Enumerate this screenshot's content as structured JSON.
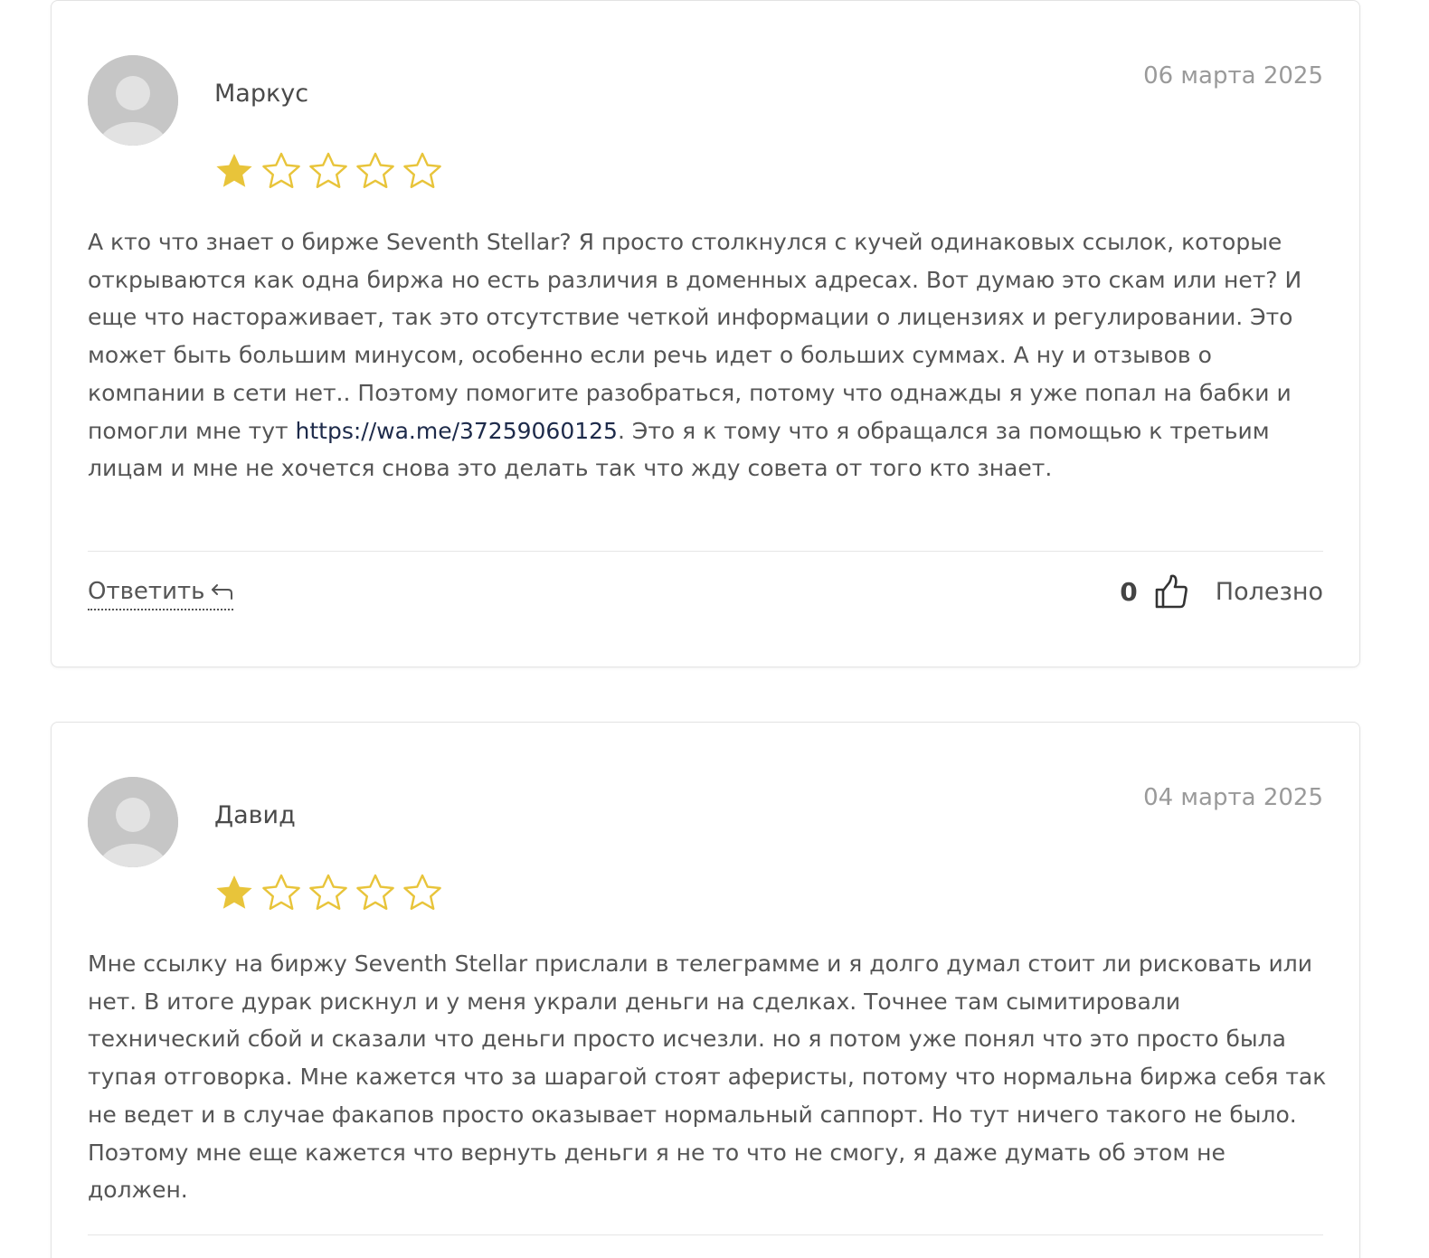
{
  "reviews": [
    {
      "author": "Маркус",
      "date": "06 марта 2025",
      "rating": 1,
      "max_rating": 5,
      "text_before_link": "А кто что знает о бирже Seventh Stellar? Я просто столкнулся с кучей одинаковых ссылок, которые открываются как одна биржа но есть различия в доменных адресах. Вот думаю это скам или нет? И еще что настораживает, так это отсутствие четкой информации о лицензиях и регулировании. Это может быть большим минусом, особенно если речь идет о больших суммах. А ну и отзывов о компании в сети нет.. Поэтому помогите разобраться, потому что однажды я уже попал на бабки и помогли мне тут ",
      "link": "https://wa.me/37259060125",
      "text_after_link": ". Это я к тому что я обращался за помощью к третьим лицам и мне не хочется снова это делать так что жду совета от того кто знает.",
      "reply_label": "Ответить",
      "helpful_count": "0",
      "helpful_label": "Полезно"
    },
    {
      "author": "Давид",
      "date": "04 марта 2025",
      "rating": 1,
      "max_rating": 5,
      "text": "Мне ссылку на биржу Seventh Stellar прислали в телеграмме и я долго думал стоит ли рисковать или нет. В итоге дурак рискнул и у меня украли деньги на сделках. Точнее там сымитировали технический сбой и сказали что деньги просто исчезли. но я потом уже понял что это просто была тупая отговорка. Мне кажется что за шарагой стоят аферисты, потому что нормальна биржа себя так не ведет и в случае факапов просто оказывает нормальный саппорт. Но тут ничего такого не было. Поэтому мне еще кажется что вернуть деньги я не то что не смогу, я даже думать об этом не должен."
    }
  ],
  "colors": {
    "star_filled": "#E8C43A",
    "star_outline": "#E8C43A",
    "text": "#555555",
    "date": "#9A9A9A",
    "link": "#1D2A4A"
  },
  "icons": {
    "reply": "reply-arrow-icon",
    "helpful": "thumbs-up-icon",
    "star": "star-icon",
    "avatar": "user-avatar-icon"
  }
}
